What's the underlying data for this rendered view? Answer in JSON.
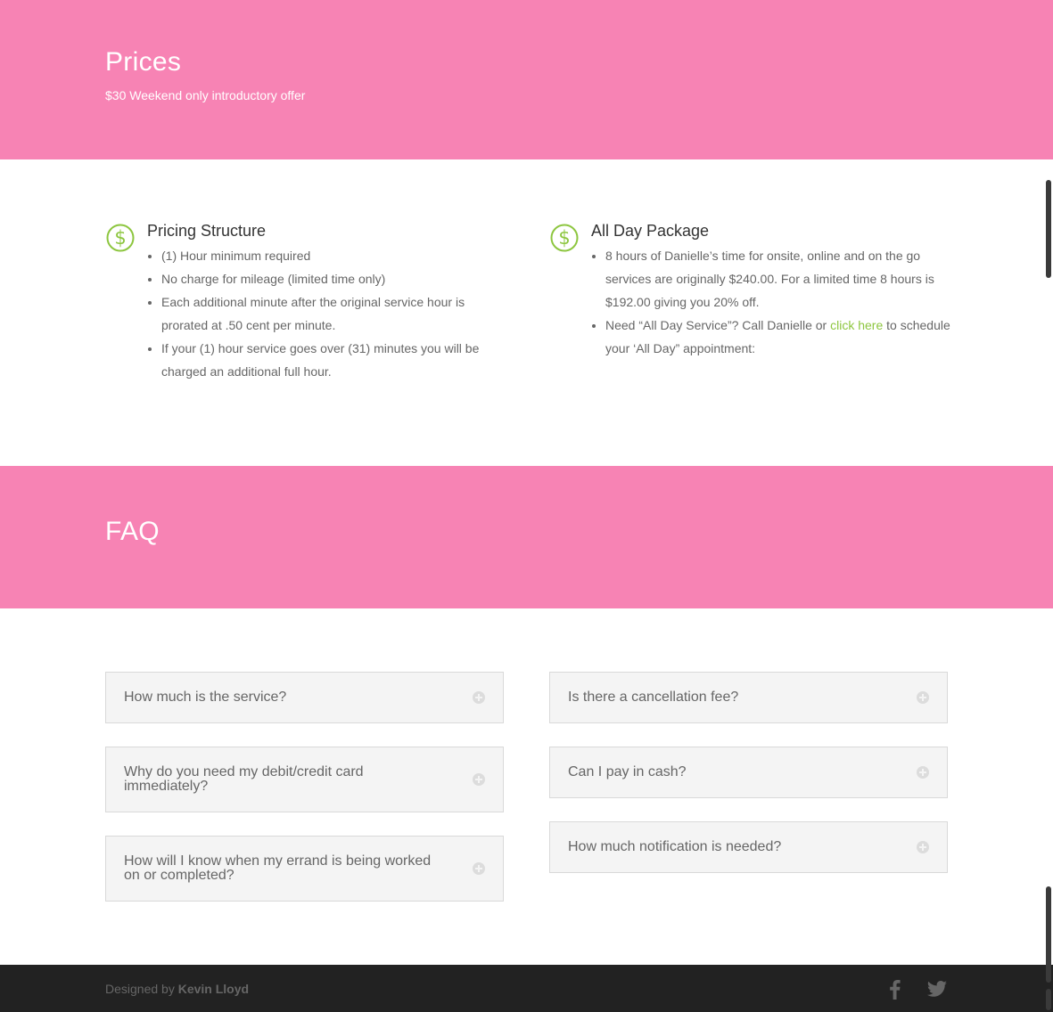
{
  "prices": {
    "title": "Prices",
    "subtitle": "$30 Weekend only introductory offer"
  },
  "pricing_structure": {
    "icon": "dollar-icon",
    "title": "Pricing Structure",
    "items": [
      "(1) Hour minimum required",
      "No charge for mileage (limited time only)",
      "Each additional minute after the original service hour is prorated at .50 cent per minute.",
      "If your (1) hour service goes over (31) minutes you will be charged an additional full hour."
    ]
  },
  "all_day": {
    "icon": "dollar-icon",
    "title": "All Day Package",
    "item1": "8 hours of Danielle’s time for onsite, online and on the go services are originally $240.00. For a limited time 8 hours is $192.00 giving you 20% off.",
    "item2_before": "Need “All Day Service”? Call Danielle or ",
    "item2_link": "click here",
    "item2_after": " to schedule your ‘All Day” appointment:"
  },
  "faq": {
    "title": "FAQ",
    "items": [
      "How much is the service?",
      "Is there a cancellation fee?",
      "Why do you need my debit/credit card immediately?",
      "Can I pay in cash?",
      "How will I know when my errand is being worked on or completed?",
      "How much notification is needed?"
    ]
  },
  "footer": {
    "designed_by": "Designed by ",
    "designer": "Kevin Lloyd",
    "social": [
      "facebook-icon",
      "twitter-icon"
    ]
  },
  "colors": {
    "band": "#f783b4",
    "accent": "#8dc63f",
    "footer": "#222222"
  }
}
